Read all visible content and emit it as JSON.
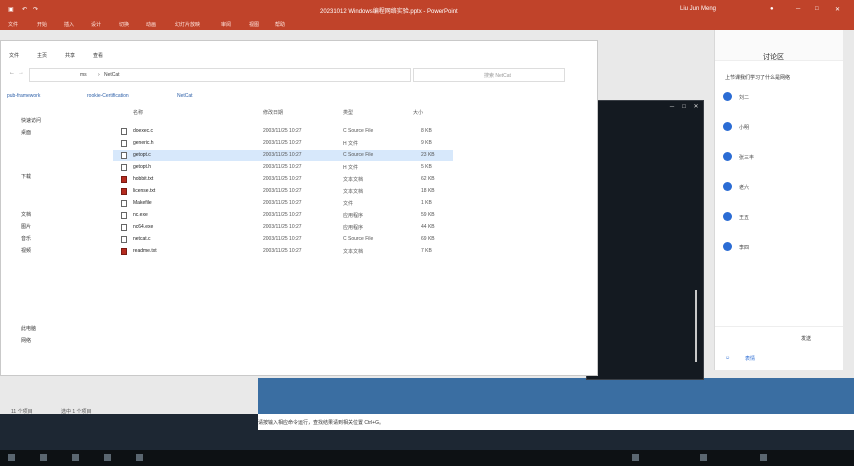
{
  "ppt": {
    "filename": "20231012 Windows编程网络实验.pptx - PowerPoint",
    "user": "Liu Jun Meng",
    "menu": [
      "文件",
      "开始",
      "插入",
      "设计",
      "切换",
      "动画",
      "幻灯片放映",
      "审阅",
      "视图",
      "帮助"
    ],
    "notes_placeholder": "请按输入相应命令运行，查找结果请到相关位置 Ctrl+G。"
  },
  "explorer": {
    "tabs": [
      "文件",
      "主页",
      "共享",
      "查看"
    ],
    "address_parts": [
      "ms",
      "NetCat"
    ],
    "search_placeholder": "搜索 NetCat",
    "breadcrumbs": [
      "pub-framework",
      "rookie-Certification",
      "NetCat"
    ],
    "nav": [
      "快速访问",
      "桌面",
      "下载",
      "文档",
      "图片",
      "音乐",
      "视频",
      "此电脑",
      "网络"
    ],
    "columns": [
      "名称",
      "修改日期",
      "类型",
      "大小"
    ],
    "files": [
      {
        "name": "doexec.c",
        "date": "2003/11/25 10:27",
        "type": "C Source File",
        "size": "8 KB",
        "icon": "file"
      },
      {
        "name": "generic.h",
        "date": "2003/11/25 10:27",
        "type": "H 文件",
        "size": "9 KB",
        "icon": "file"
      },
      {
        "name": "getopt.c",
        "date": "2003/11/25 10:27",
        "type": "C Source File",
        "size": "23 KB",
        "icon": "file",
        "selected": true
      },
      {
        "name": "getopt.h",
        "date": "2003/11/25 10:27",
        "type": "H 文件",
        "size": "5 KB",
        "icon": "file"
      },
      {
        "name": "hobbit.txt",
        "date": "2003/11/25 10:27",
        "type": "文本文档",
        "size": "62 KB",
        "icon": "txt-red"
      },
      {
        "name": "license.txt",
        "date": "2003/11/25 10:27",
        "type": "文本文档",
        "size": "18 KB",
        "icon": "txt-red"
      },
      {
        "name": "Makefile",
        "date": "2003/11/25 10:27",
        "type": "文件",
        "size": "1 KB",
        "icon": "file"
      },
      {
        "name": "nc.exe",
        "date": "2003/11/25 10:27",
        "type": "应用程序",
        "size": "59 KB",
        "icon": "file"
      },
      {
        "name": "nc64.exe",
        "date": "2003/11/25 10:27",
        "type": "应用程序",
        "size": "44 KB",
        "icon": "file"
      },
      {
        "name": "netcat.c",
        "date": "2003/11/25 10:27",
        "type": "C Source File",
        "size": "69 KB",
        "icon": "file"
      },
      {
        "name": "readme.txt",
        "date": "2003/11/25 10:27",
        "type": "文本文档",
        "size": "7 KB",
        "icon": "txt-red"
      }
    ],
    "status": [
      "11 个项目",
      "选中 1 个项目"
    ]
  },
  "chat": {
    "title": "讨论区",
    "subtitle": "上节课我们学习了什么是网络",
    "items": [
      "刘二",
      "小明",
      "张三丰",
      "老六",
      "王五",
      "李四"
    ],
    "footer": [
      "发送",
      "表情"
    ]
  },
  "colors": {
    "ppt_red": "#c0432a",
    "chat_blue": "#2b6cd4",
    "slide_blue": "#3a6ea2"
  }
}
